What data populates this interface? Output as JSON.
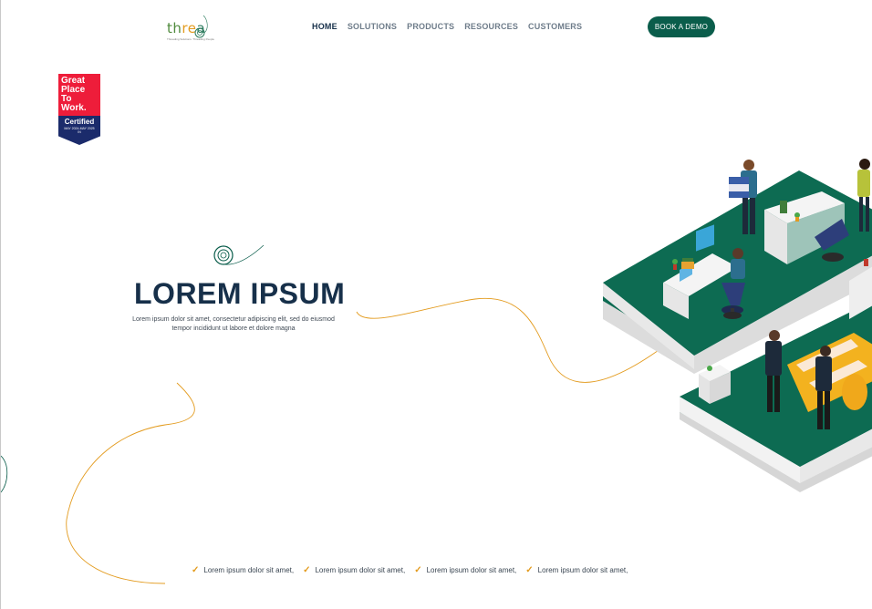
{
  "logo": {
    "part1": "th",
    "part2": "re",
    "part3": "a",
    "tagline": "Threading Solutions. Threading People"
  },
  "nav": {
    "items": [
      {
        "label": "HOME",
        "active": true
      },
      {
        "label": "SOLUTIONS",
        "active": false
      },
      {
        "label": "PRODUCTS",
        "active": false
      },
      {
        "label": "RESOURCES",
        "active": false
      },
      {
        "label": "CUSTOMERS",
        "active": false
      }
    ]
  },
  "cta": {
    "label": "BOOK A DEMO"
  },
  "badge": {
    "line1": "Great",
    "line2": "Place",
    "line3": "To",
    "line4": "Work.",
    "certified": "Certified",
    "dates": "MAY 2024-MAY 2025",
    "country": "IN"
  },
  "hero": {
    "title": "LOREM IPSUM",
    "subtitle": "Lorem ipsum dolor sit amet, consectetur adipiscing elit, sed do eiusmod tempor incididunt ut labore et dolore magna"
  },
  "features": [
    {
      "text": "Lorem ipsum dolor sit amet,"
    },
    {
      "text": "Lorem ipsum dolor sit amet,"
    },
    {
      "text": "Lorem ipsum dolor sit amet,"
    },
    {
      "text": "Lorem ipsum dolor sit amet,"
    }
  ],
  "colors": {
    "brand_dark": "#17304a",
    "brand_green": "#0a5d4b",
    "accent_orange": "#e39b1e",
    "badge_red": "#ee1d3a",
    "badge_navy": "#1b2b6b"
  }
}
